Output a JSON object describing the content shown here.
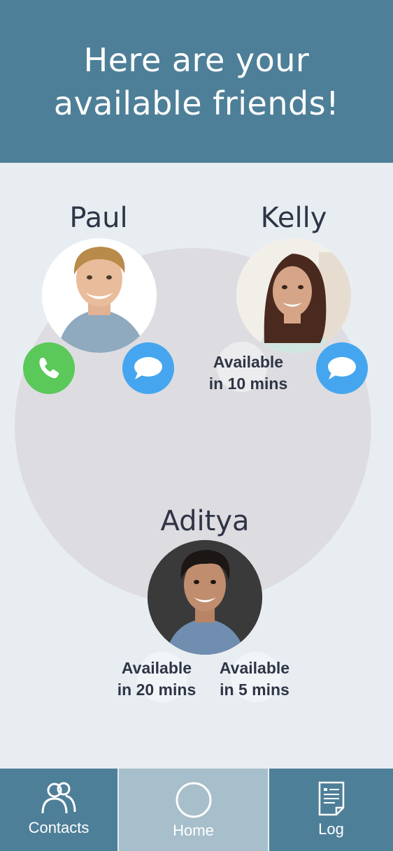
{
  "header": {
    "title_line1": "Here are your",
    "title_line2": "available friends!",
    "color": "#4e7f98"
  },
  "friends": [
    {
      "name": "Paul",
      "actions": [
        "phone-icon",
        "message-icon"
      ]
    },
    {
      "name": "Kelly",
      "availability_line1": "Available",
      "availability_line2": "in 10 mins",
      "actions": [
        "message-icon"
      ]
    },
    {
      "name": "Aditya"
    }
  ],
  "pending": [
    {
      "line1": "Available",
      "line2": "in 20 mins"
    },
    {
      "line1": "Available",
      "line2": "in 5 mins"
    }
  ],
  "tabs": [
    {
      "label": "Contacts",
      "icon": "contacts-icon"
    },
    {
      "label": "Home",
      "icon": "home-circle-icon",
      "active": true
    },
    {
      "label": "Log",
      "icon": "log-document-icon"
    }
  ],
  "colors": {
    "call": "#5bc85a",
    "message": "#45a6ef",
    "tab_active": "#a7bfca",
    "background": "#e8edf2"
  }
}
